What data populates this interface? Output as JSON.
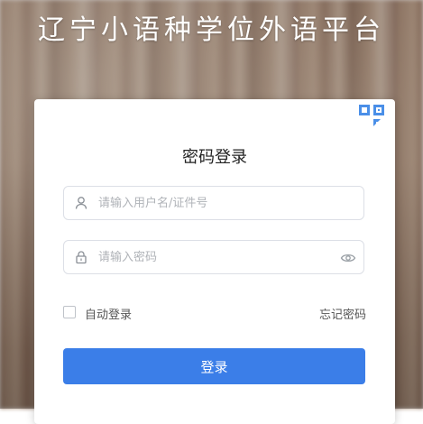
{
  "header": {
    "title": "辽宁小语种学位外语平台"
  },
  "login": {
    "title": "密码登录",
    "username_placeholder": "请输入用户名/证件号",
    "password_placeholder": "请输入密码",
    "remember_label": "自动登录",
    "remember_checked": false,
    "forgot_label": "忘记密码",
    "submit_label": "登录",
    "icons": {
      "qr": "qr-code-icon",
      "user": "user-icon",
      "lock": "lock-icon",
      "eye": "eye-icon"
    }
  },
  "colors": {
    "accent": "#3b7ee8",
    "qr": "#4a8fe8"
  }
}
